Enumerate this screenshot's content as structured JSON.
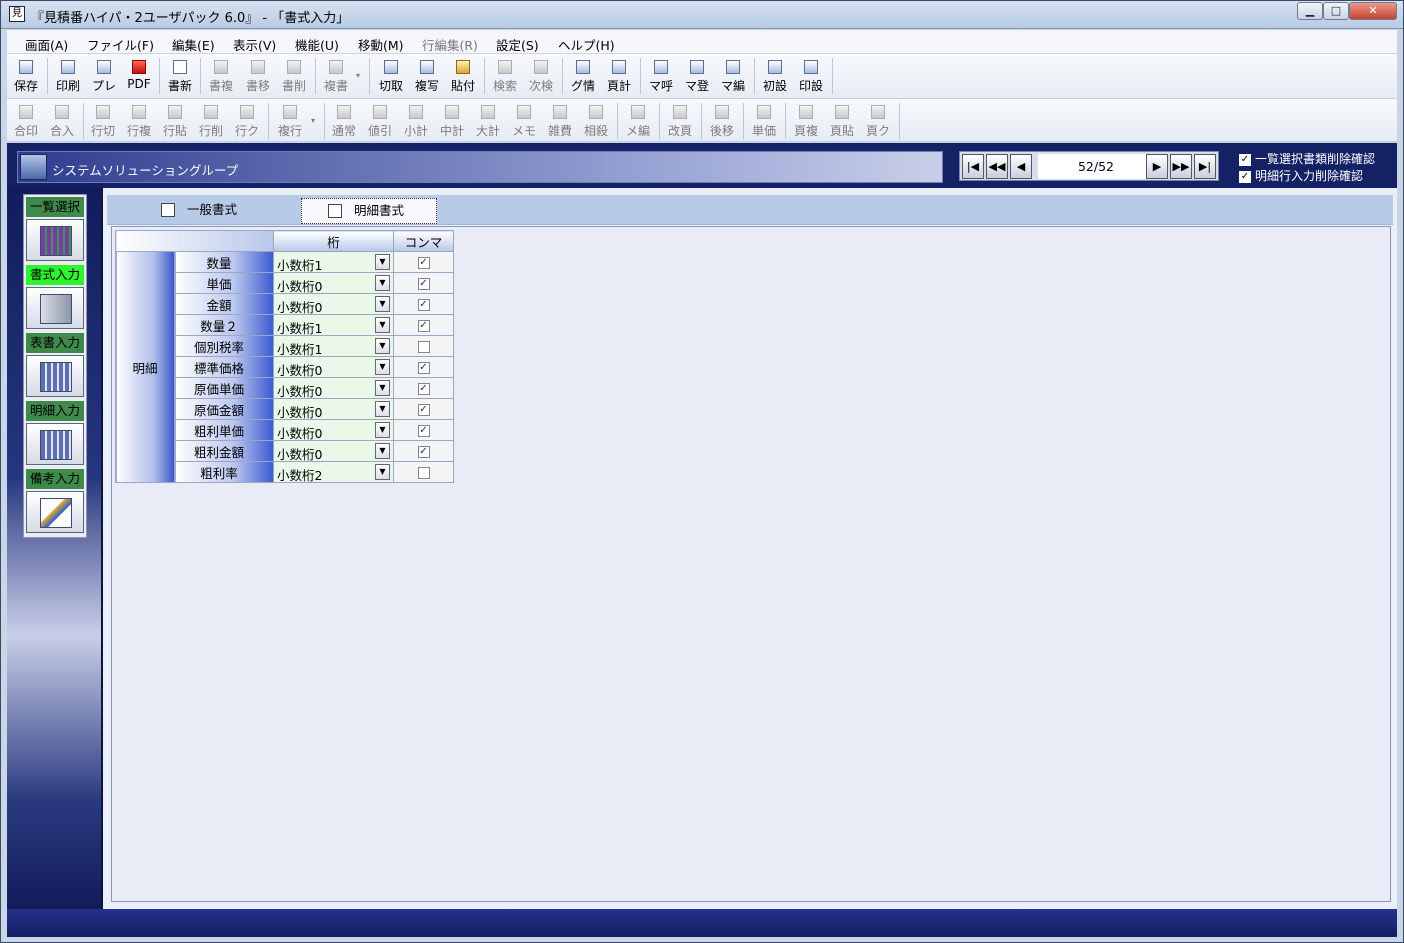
{
  "window": {
    "title": "『見積番ハイパ・2ユーザパック 6.0』 - 「書式入力」"
  },
  "menu": [
    "画面(A)",
    "ファイル(F)",
    "編集(E)",
    "表示(V)",
    "機能(U)",
    "移動(M)",
    "行編集(R)",
    "設定(S)",
    "ヘルプ(H)"
  ],
  "toolbar1": [
    "保存",
    "印刷",
    "プレ",
    "PDF",
    "書新",
    "書複",
    "書移",
    "書削",
    "複書",
    "切取",
    "複写",
    "貼付",
    "検索",
    "次検",
    "グ情",
    "頁計",
    "マ呼",
    "マ登",
    "マ編",
    "初設",
    "印設"
  ],
  "toolbar2": [
    "合印",
    "合入",
    "行切",
    "行複",
    "行貼",
    "行削",
    "行ク",
    "複行",
    "通常",
    "値引",
    "小計",
    "中計",
    "大計",
    "メモ",
    "雑費",
    "相殺",
    "メ編",
    "改頁",
    "後移",
    "単価",
    "頁複",
    "頁貼",
    "頁ク"
  ],
  "nav": {
    "group": "システムソリューショングループ",
    "page": "52/52",
    "btn_first": "|◀",
    "btn_prev_page": "◀◀",
    "btn_prev": "◀",
    "btn_next": "▶",
    "btn_next_page": "▶▶",
    "btn_last": "▶|",
    "chk1": "一覧選択書類削除確認",
    "chk2": "明細行入力削除確認"
  },
  "side": {
    "list": "一覧選択",
    "format": "書式入力",
    "cover": "表書入力",
    "detail": "明細入力",
    "note": "備考入力"
  },
  "tabs": {
    "general": "一般書式",
    "detail": "明細書式"
  },
  "grid": {
    "col_digit": "桁",
    "col_comma": "コンマ",
    "section": "明細",
    "rows": [
      {
        "label": "数量",
        "value": "小数桁1",
        "comma": true
      },
      {
        "label": "単価",
        "value": "小数桁0",
        "comma": true
      },
      {
        "label": "金額",
        "value": "小数桁0",
        "comma": true
      },
      {
        "label": "数量２",
        "value": "小数桁1",
        "comma": true
      },
      {
        "label": "個別税率",
        "value": "小数桁1",
        "comma": false
      },
      {
        "label": "標準価格",
        "value": "小数桁0",
        "comma": true
      },
      {
        "label": "原価単価",
        "value": "小数桁0",
        "comma": true
      },
      {
        "label": "原価金額",
        "value": "小数桁0",
        "comma": true
      },
      {
        "label": "粗利単価",
        "value": "小数桁0",
        "comma": true
      },
      {
        "label": "粗利金額",
        "value": "小数桁0",
        "comma": true
      },
      {
        "label": "粗利率",
        "value": "小数桁2",
        "comma": false
      }
    ]
  }
}
